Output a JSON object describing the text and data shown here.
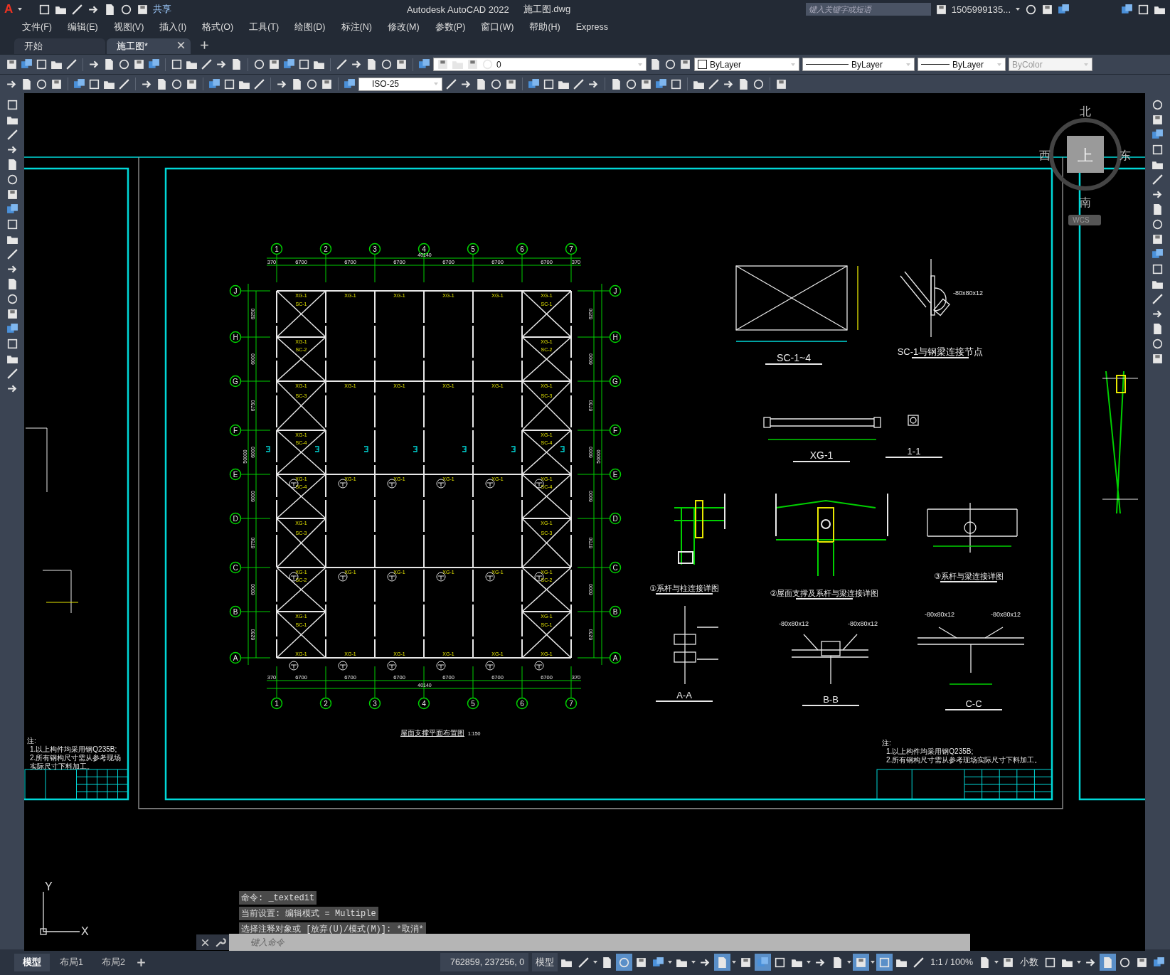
{
  "title_bar": {
    "logo": "A",
    "share": "共享",
    "app_title": "Autodesk AutoCAD 2022",
    "file_name": "施工图.dwg",
    "search": {
      "placeholder": "键入关键字或短语"
    },
    "user": "1505999135..."
  },
  "menu": [
    "文件(F)",
    "编辑(E)",
    "视图(V)",
    "插入(I)",
    "格式(O)",
    "工具(T)",
    "绘图(D)",
    "标注(N)",
    "修改(M)",
    "参数(P)",
    "窗口(W)",
    "帮助(H)",
    "Express"
  ],
  "doc_tabs": [
    {
      "label": "开始",
      "selected": false
    },
    {
      "label": "施工图*",
      "selected": true
    }
  ],
  "toolbar": {
    "layer": "0",
    "color_setting": "ByLayer",
    "linetype": "ByLayer",
    "lineweight": "ByLayer",
    "plot_style": {
      "value": "ByColor",
      "disabled": true
    },
    "dim_style": "ISO-25"
  },
  "plan": {
    "title": "屋面支撑平面布置图",
    "scale": "1:150",
    "top_column_axes": [
      "1",
      "2",
      "3",
      "4",
      "5",
      "6",
      "7"
    ],
    "bottom_column_axes": [
      "1",
      "2",
      "3",
      "4",
      "5",
      "6",
      "7"
    ],
    "left_row_axes": [
      "J",
      "H",
      "G",
      "F",
      "E",
      "D",
      "C",
      "B",
      "A"
    ],
    "right_row_axes": [
      "J",
      "H",
      "G",
      "F",
      "E",
      "D",
      "C",
      "B",
      "A"
    ],
    "top_span_dims": [
      "370",
      "6700",
      "6700",
      "6700",
      "6700",
      "6700",
      "6700",
      "370"
    ],
    "top_total": "40140",
    "bottom_span_dims": [
      "370",
      "6700",
      "6700",
      "6700",
      "6700",
      "6700",
      "6700",
      "370"
    ],
    "bottom_total": "40140",
    "left_bay_dims": [
      "6250",
      "6000",
      "6750",
      "6000",
      "6000",
      "6750",
      "6000",
      "6250"
    ],
    "left_total": "50000",
    "right_bay_dims": [
      "6250",
      "6000",
      "6750",
      "6000",
      "6000",
      "6750",
      "6000",
      "6250"
    ],
    "right_total": "50000",
    "beam_rows": [
      {
        "kind": "full",
        "labels": [
          "XG-1",
          "XG-1",
          "XG-1",
          "XG-1",
          "XG-1",
          "XG-1"
        ]
      },
      {
        "kind": "end_bays",
        "labels": [
          "XG-1",
          "XG-1"
        ]
      },
      {
        "kind": "full",
        "labels": [
          "XG-1",
          "XG-1",
          "XG-1",
          "XG-1",
          "XG-1",
          "XG-1"
        ]
      },
      {
        "kind": "end_bays",
        "labels": [
          "XG-1",
          "XG-1"
        ]
      },
      {
        "kind": "full",
        "labels": [
          "XG-1",
          "XG-1",
          "XG-1",
          "XG-1",
          "XG-1",
          "XG-1"
        ]
      },
      {
        "kind": "end_bays",
        "labels": [
          "XG-1",
          "XG-1"
        ]
      },
      {
        "kind": "full",
        "labels": [
          "XG-1",
          "XG-1",
          "XG-1",
          "XG-1",
          "XG-1",
          "XG-1"
        ]
      },
      {
        "kind": "end_bays",
        "labels": [
          "XG-1",
          "XG-1"
        ]
      },
      {
        "kind": "full",
        "labels": [
          "XG-1",
          "XG-1",
          "XG-1",
          "XG-1",
          "XG-1",
          "XG-1"
        ]
      }
    ],
    "left_bracing": [
      "SC-1",
      "SC-2",
      "SC-3",
      "SC-4",
      "SC-4",
      "SC-3",
      "SC-2",
      "SC-1"
    ],
    "right_bracing": [
      "SC-1",
      "SC-2",
      "SC-3",
      "SC-4",
      "SC-4",
      "SC-3",
      "SC-2",
      "SC-1"
    ]
  },
  "details": [
    {
      "kind": "brace-frame",
      "title": "SC-1~4"
    },
    {
      "kind": "brace-node",
      "title": "SC-1与钢梁连接节点",
      "labels": [
        "-80x80x12"
      ]
    },
    {
      "kind": "strut",
      "title": "XG-1"
    },
    {
      "kind": "section-square",
      "title": "1-1"
    },
    {
      "kind": "column-joint",
      "title": "①系杆与柱连接详图"
    },
    {
      "kind": "beam-joint",
      "title": "②屋面支撑及系杆与梁连接详图"
    },
    {
      "kind": "strut-joint",
      "title": "③系杆与梁连接详图"
    },
    {
      "kind": "section-aa",
      "title": "A-A"
    },
    {
      "kind": "section-bb",
      "title": "B-B",
      "labels": [
        "-80x80x12",
        "-80x80x12"
      ]
    },
    {
      "kind": "section-cc",
      "title": "C-C",
      "labels": [
        "-80x80x12",
        "-80x80x12"
      ]
    }
  ],
  "notes": {
    "heading": "注:",
    "lines": [
      "1.以上构件均采用钢Q235B;",
      "2.所有钢构尺寸需从参考现场实际尺寸下料加工。"
    ]
  },
  "left_sheet_notes": {
    "heading": "注:",
    "lines": [
      "1.以上构件均采用钢Q235B;",
      "2.所有钢构尺寸需从参考现场实际尺寸下料加工。"
    ]
  },
  "compass": {
    "north": "北",
    "south": "南",
    "west": "西",
    "east": "东",
    "face": "上",
    "ucs": "WCS"
  },
  "ucs_icon": {
    "x": "X",
    "y": "Y"
  },
  "command": {
    "history": [
      "命令: _textedit",
      "当前设置: 编辑模式 = Multiple",
      "选择注释对象或 [放弃(U)/模式(M)]: *取消*"
    ],
    "placeholder": "键入命令"
  },
  "layout_tabs": [
    {
      "label": "模型",
      "selected": true
    },
    {
      "label": "布局1",
      "selected": false
    },
    {
      "label": "布局2",
      "selected": false
    }
  ],
  "status_items": [
    {
      "kind": "coords",
      "text": "762859, 237256, 0"
    },
    {
      "kind": "button",
      "text": "模型"
    },
    {
      "kind": "toggle",
      "on": false
    },
    {
      "kind": "toggle",
      "on": false
    },
    {
      "kind": "caret"
    },
    {
      "kind": "toggle",
      "on": false
    },
    {
      "kind": "toggle",
      "on": true
    },
    {
      "kind": "toggle",
      "on": false
    },
    {
      "kind": "toggle",
      "on": false
    },
    {
      "kind": "caret"
    },
    {
      "kind": "toggle",
      "on": false
    },
    {
      "kind": "caret"
    },
    {
      "kind": "toggle",
      "on": false
    },
    {
      "kind": "toggle",
      "on": true
    },
    {
      "kind": "caret"
    },
    {
      "kind": "toggle",
      "on": false
    },
    {
      "kind": "toggle",
      "on": true
    },
    {
      "kind": "toggle",
      "on": false
    },
    {
      "kind": "toggle",
      "on": false
    },
    {
      "kind": "caret"
    },
    {
      "kind": "toggle",
      "on": false
    },
    {
      "kind": "toggle",
      "on": false
    },
    {
      "kind": "caret"
    },
    {
      "kind": "toggle",
      "on": true
    },
    {
      "kind": "caret"
    },
    {
      "kind": "toggle",
      "on": true
    },
    {
      "kind": "toggle",
      "on": false
    },
    {
      "kind": "toggle",
      "on": false
    },
    {
      "kind": "dropdown",
      "text": "1:1 / 100%"
    },
    {
      "kind": "toggle",
      "on": false
    },
    {
      "kind": "caret"
    },
    {
      "kind": "toggle",
      "on": false
    },
    {
      "kind": "dropdown",
      "text": "小数"
    },
    {
      "kind": "toggle",
      "on": false
    },
    {
      "kind": "toggle",
      "on": false
    },
    {
      "kind": "caret"
    },
    {
      "kind": "toggle",
      "on": false
    },
    {
      "kind": "toggle",
      "on": true
    },
    {
      "kind": "toggle",
      "on": false
    },
    {
      "kind": "toggle",
      "on": false
    },
    {
      "kind": "toggle",
      "on": false
    }
  ]
}
